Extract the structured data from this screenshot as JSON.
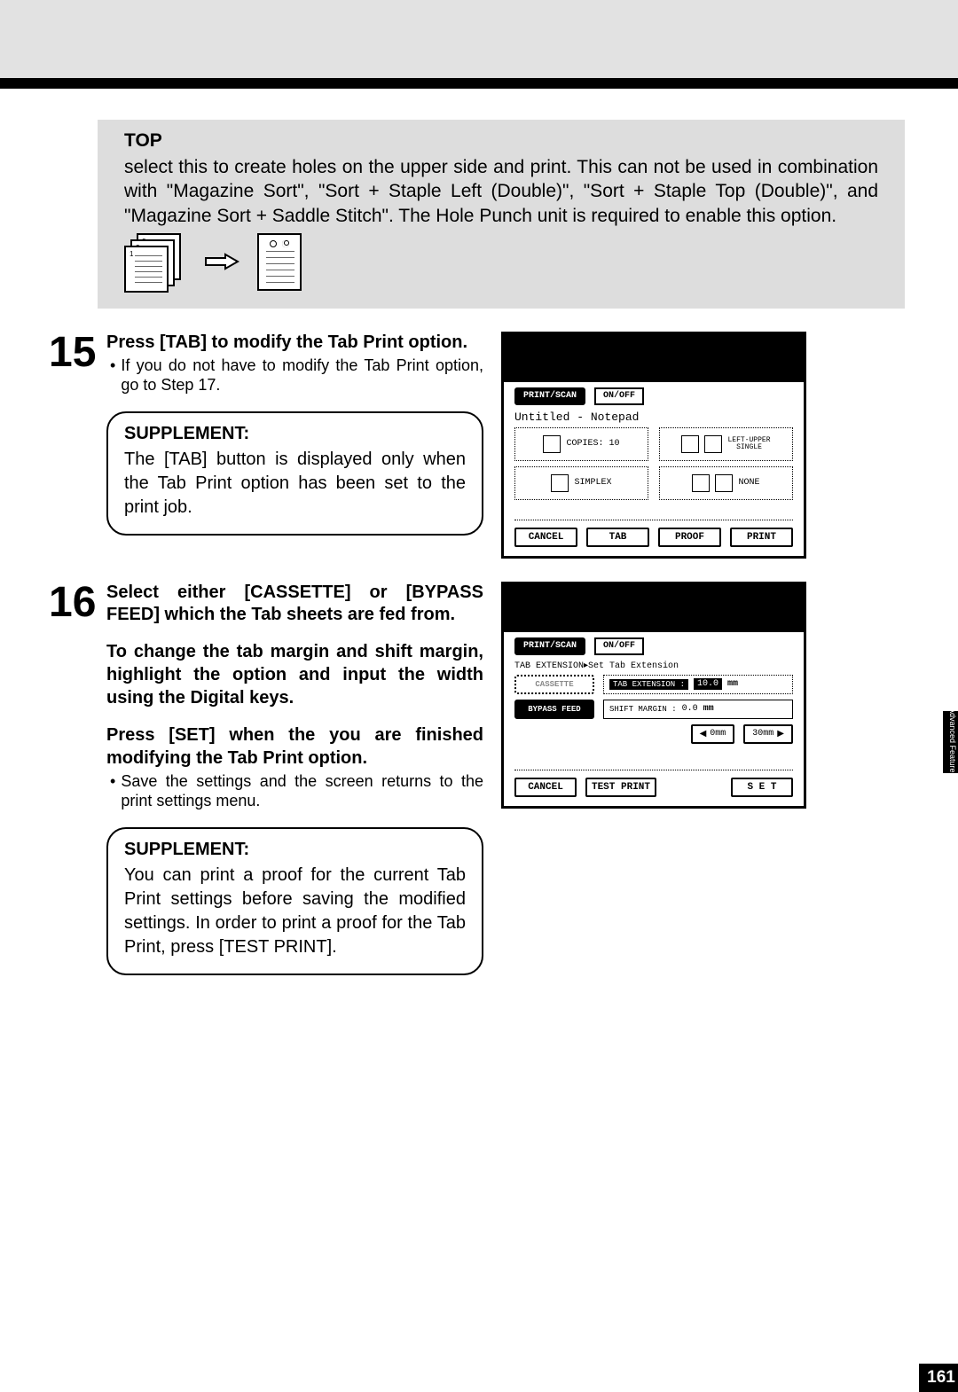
{
  "topBox": {
    "title": "TOP",
    "body": "select this to create holes on the upper side and print.  This can not be used in combination with \"Magazine Sort\", \"Sort + Staple Left (Double)\", \"Sort + Staple Top (Double)\", and \"Magazine Sort + Saddle Stitch\".  The Hole Punch unit is required to enable this option."
  },
  "step15": {
    "num": "15",
    "title": "Press [TAB] to modify the Tab Print option.",
    "bullet": "If you do not have to modify the Tab Print option, go to Step 17.",
    "supp_title": "SUPPLEMENT:",
    "supp_body": "The [TAB] button is displayed only when the Tab Print option has been set to the print job."
  },
  "step16": {
    "num": "16",
    "title": "Select either [CASSETTE] or [BYPASS FEED] which the Tab sheets are fed from.",
    "para1": "To change the tab margin and shift margin, highlight the option and input the width using the Digital keys.",
    "para2": "Press [SET] when the you are finished modifying the Tab Print option.",
    "bullet": "Save the settings and the screen returns to the print settings menu.",
    "supp_title": "SUPPLEMENT:",
    "supp_body": "You can print a proof for the current Tab Print settings before saving the modified settings.  In order to print a proof for the Tab Print, press [TEST PRINT]."
  },
  "screen1": {
    "tab1": "PRINT/SCAN",
    "tab2": "ON/OFF",
    "title": "Untitled - Notepad",
    "copies_lab": "COPIES:",
    "copies_val": "10",
    "leftupper": "LEFT-UPPER\nSINGLE",
    "simplex": "SIMPLEX",
    "none": "NONE",
    "b_cancel": "CANCEL",
    "b_tab": "TAB",
    "b_proof": "PROOF",
    "b_print": "PRINT"
  },
  "screen2": {
    "tab1": "PRINT/SCAN",
    "tab2": "ON/OFF",
    "title": "TAB EXTENSION▸Set Tab Extension",
    "src1": "CASSETTE",
    "src2": "BYPASS FEED",
    "ext_lab": "TAB EXTENSION :",
    "ext_val": "10.0",
    "ext_unit": "mm",
    "shift_lab": "SHIFT MARGIN :",
    "shift_val": "0.0",
    "shift_unit": "mm",
    "chip1": "0mm",
    "chip2": "30mm",
    "b_cancel": "CANCEL",
    "b_test": "TEST PRINT",
    "b_set": "S E T"
  },
  "side": "Advanced Features",
  "pagenum": "161"
}
